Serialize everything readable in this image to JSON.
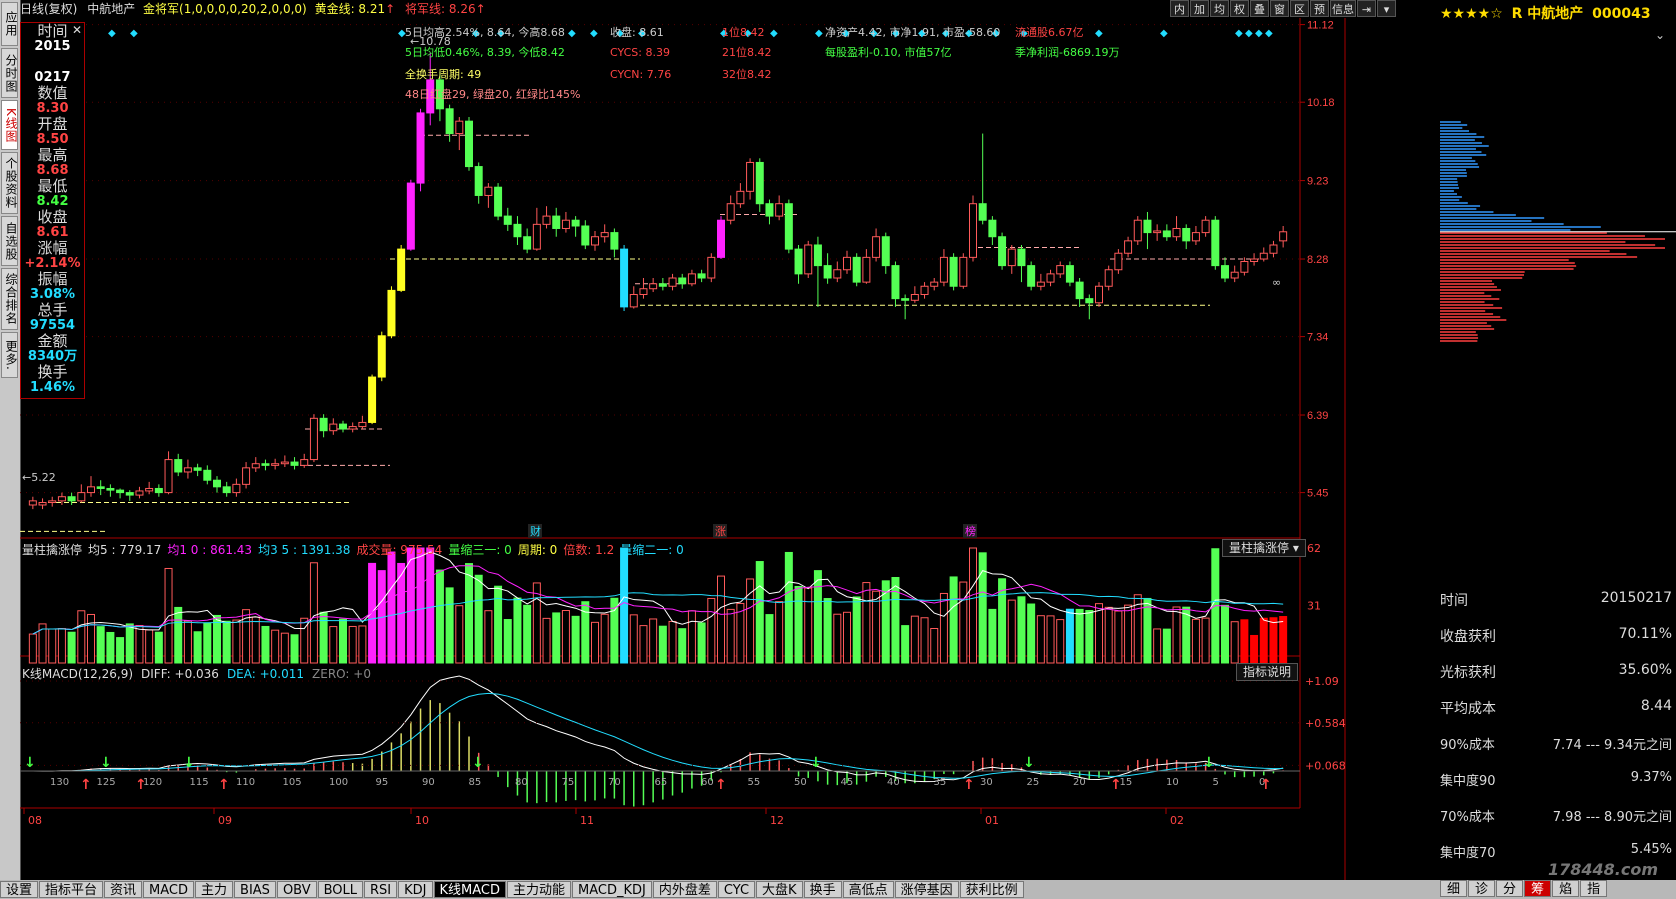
{
  "colors": {
    "up": "#ff5a5a",
    "down": "#54ff54",
    "accent_magenta": "#ff22ff",
    "accent_yellow": "#ffff22",
    "accent_cyan": "#22ddff",
    "axis": "#aa0000",
    "grid": "#550000"
  },
  "sidebar": [
    {
      "label": "应用"
    },
    {
      "label": "分时图"
    },
    {
      "label": "K线图",
      "active": true
    },
    {
      "label": "个股资料"
    },
    {
      "label": "自选股"
    },
    {
      "label": "综合排名"
    },
    {
      "label": "更多."
    }
  ],
  "topbar": {
    "period": "日线(复权)",
    "stock": "中航地产",
    "indicator": "金将军(1,0,0,0,0,20,2,0,0,0)",
    "gold_label": "黄金线: 8.21",
    "gold_arrow": "↑",
    "general_label": "将军线: 8.26",
    "general_arrow": "↑"
  },
  "toolbar": [
    "内",
    "加",
    "均",
    "权",
    "叠",
    "窗",
    "区",
    "预",
    "信息",
    "⇥",
    "▾"
  ],
  "infobox": [
    {
      "label": "时间",
      "value": "2015",
      "color": "#ffffff"
    },
    {
      "label": "",
      "value": "0217",
      "color": "#ffffff"
    },
    {
      "label": "数值",
      "value": "8.30",
      "color": "#ff4444"
    },
    {
      "label": "开盘",
      "value": "8.50",
      "color": "#ff4444"
    },
    {
      "label": "最高",
      "value": "8.68",
      "color": "#ff4444"
    },
    {
      "label": "最低",
      "value": "8.42",
      "color": "#44ff44"
    },
    {
      "label": "收盘",
      "value": "8.61",
      "color": "#ff4444"
    },
    {
      "label": "涨幅",
      "value": "+2.14%",
      "color": "#ff4444"
    },
    {
      "label": "振幅",
      "value": "3.08%",
      "color": "#22ddff"
    },
    {
      "label": "总手",
      "value": "97554",
      "color": "#22ddff"
    },
    {
      "label": "金额",
      "value": "8340万",
      "color": "#22ddff"
    },
    {
      "label": "换手",
      "value": "1.46%",
      "color": "#22ddff"
    }
  ],
  "overlay": [
    {
      "text": "5日均高2.54%, 8.64, 今高8.68",
      "color": "#ccc"
    },
    {
      "text": "5日均低0.46%, 8.39, 今低8.42",
      "color": "#44ff44"
    },
    {
      "text": "全换手周期: 49",
      "color": "#ffff66"
    },
    {
      "text": "48日红盘29, 绿盘20, 红绿比145%",
      "color": "#ff8888"
    },
    {
      "text": "收盘: 8.61",
      "color": "#ccc"
    },
    {
      "text": "CYCS: 8.39",
      "color": "#ff4444"
    },
    {
      "text": "CYCN: 7.76",
      "color": "#ff4444"
    },
    {
      "text": "1位8.42",
      "color": "#ff4444"
    },
    {
      "text": "21位8.42",
      "color": "#ff4444"
    },
    {
      "text": "32位8.42",
      "color": "#ff4444"
    },
    {
      "text": "净资产4.42, 市净1.91, 市盈-58.60",
      "color": "#ccc"
    },
    {
      "text": "每股盈利-0.10, 市值57亿",
      "color": "#44ff44"
    },
    {
      "text": "流通股6.67亿",
      "color": "#ff4444"
    },
    {
      "text": "季净利润-6869.19万",
      "color": "#44ff44"
    },
    {
      "text": "←10.78",
      "color": "#ccc"
    },
    {
      "text": "←5.22",
      "color": "#ccc"
    },
    {
      "text": "∞",
      "color": "#ccc"
    }
  ],
  "event_tags": [
    {
      "text": "财",
      "color": "#22ddff"
    },
    {
      "text": "涨",
      "color": "#ff4444"
    },
    {
      "text": "榜",
      "color": "#ff22ff"
    }
  ],
  "price_axis": [
    "11.12",
    "10.18",
    "9.23",
    "8.28",
    "7.34",
    "6.39",
    "5.45"
  ],
  "vol_header": {
    "name": "量柱擒涨停",
    "ma5": "均5 : 779.17",
    "ma1": "均1 0 : 861.43",
    "ma35": "均3 5 : 1391.38",
    "vol": "成交量: 975.54",
    "s3": "量缩三一: 0",
    "cycle": "周期: 0",
    "mult": "倍数: 1.2",
    "s2": "量缩二一: 0",
    "dropdown": "量柱擒涨停 ▾"
  },
  "vol_axis": [
    "62",
    "31"
  ],
  "macd_header": {
    "name": "K线MACD(12,26,9)",
    "diff": "DIFF: +0.036",
    "dea": "DEA: +0.011",
    "zero": "ZERO: +0",
    "help": "指标说明"
  },
  "macd_axis": [
    "+1.09",
    "+0.584",
    "+0.068"
  ],
  "macd_countdown": [
    "130",
    "125",
    "120",
    "115",
    "110",
    "105",
    "100",
    "95",
    "90",
    "85",
    "80",
    "75",
    "70",
    "65",
    "60",
    "55",
    "50",
    "45",
    "40",
    "35",
    "30",
    "25",
    "20",
    "15",
    "10",
    "5",
    "0"
  ],
  "months": [
    "08",
    "09",
    "10",
    "11",
    "12",
    "01",
    "02"
  ],
  "right": {
    "title": "R 中航地产",
    "code": "000043",
    "stars": "★★★★☆"
  },
  "stats": [
    {
      "label": "时间",
      "value": "20150217"
    },
    {
      "label": "收盘获利",
      "value": "70.11%"
    },
    {
      "label": "光标获利",
      "value": "35.60%"
    },
    {
      "label": "平均成本",
      "value": "8.44"
    },
    {
      "label": "90%成本",
      "value": "7.74 --- 9.34元之间"
    },
    {
      "label": "集中度90",
      "value": "9.37%"
    },
    {
      "label": "70%成本",
      "value": "7.98 --- 8.90元之间"
    },
    {
      "label": "集中度70",
      "value": "5.45%"
    }
  ],
  "watermark": "178448.com",
  "bottom_tabs": [
    "设置",
    "指标平台",
    "资讯",
    "MACD",
    "主力",
    "BIAS",
    "OBV",
    "BOLL",
    "RSI",
    "KDJ",
    "K线MACD",
    "主力动能",
    "MACD_KDJ",
    "内外盘差",
    "CYC",
    "大盘K",
    "换手",
    "高低点",
    "涨停基因",
    "获利比例"
  ],
  "bottom_active": "K线MACD",
  "right_tabs": [
    "细",
    "诊",
    "分",
    "筹",
    "焰",
    "指"
  ],
  "right_active": "筹",
  "chart_data": {
    "type": "candlestick",
    "price_range": [
      4.9,
      11.2
    ],
    "candles": [
      [
        5.3,
        5.35,
        5.4,
        5.25
      ],
      [
        5.3,
        5.33,
        5.38,
        5.25
      ],
      [
        5.33,
        5.35,
        5.4,
        5.28
      ],
      [
        5.35,
        5.4,
        5.45,
        5.3
      ],
      [
        5.4,
        5.35,
        5.45,
        5.3
      ],
      [
        5.35,
        5.45,
        5.55,
        5.33
      ],
      [
        5.45,
        5.52,
        5.65,
        5.4
      ],
      [
        5.52,
        5.5,
        5.6,
        5.42
      ],
      [
        5.5,
        5.48,
        5.55,
        5.4
      ],
      [
        5.48,
        5.45,
        5.5,
        5.38
      ],
      [
        5.45,
        5.42,
        5.48,
        5.35
      ],
      [
        5.42,
        5.47,
        5.52,
        5.38
      ],
      [
        5.47,
        5.5,
        5.58,
        5.43
      ],
      [
        5.5,
        5.45,
        5.55,
        5.4
      ],
      [
        5.45,
        5.85,
        5.95,
        5.43
      ],
      [
        5.85,
        5.7,
        5.92,
        5.65
      ],
      [
        5.7,
        5.75,
        5.85,
        5.62
      ],
      [
        5.75,
        5.72,
        5.8,
        5.65
      ],
      [
        5.72,
        5.6,
        5.78,
        5.55
      ],
      [
        5.6,
        5.52,
        5.65,
        5.45
      ],
      [
        5.52,
        5.45,
        5.58,
        5.4
      ],
      [
        5.45,
        5.55,
        5.62,
        5.4
      ],
      [
        5.55,
        5.75,
        5.82,
        5.5
      ],
      [
        5.75,
        5.8,
        5.88,
        5.7
      ],
      [
        5.8,
        5.78,
        5.85,
        5.72
      ],
      [
        5.78,
        5.8,
        5.86,
        5.73
      ],
      [
        5.8,
        5.82,
        5.9,
        5.76
      ],
      [
        5.82,
        5.78,
        5.88,
        5.73
      ],
      [
        5.78,
        5.85,
        5.92,
        5.75
      ],
      [
        5.85,
        6.35,
        6.4,
        5.82
      ],
      [
        6.35,
        6.2,
        6.4,
        6.12
      ],
      [
        6.2,
        6.28,
        6.35,
        6.15
      ],
      [
        6.28,
        6.22,
        6.32,
        6.18
      ],
      [
        6.22,
        6.25,
        6.3,
        6.18
      ],
      [
        6.25,
        6.3,
        6.38,
        6.22
      ],
      [
        6.3,
        6.85,
        6.88,
        6.28
      ],
      [
        6.85,
        7.35,
        7.4,
        6.8
      ],
      [
        7.35,
        7.9,
        7.95,
        7.32
      ],
      [
        7.9,
        8.4,
        8.45,
        7.88
      ],
      [
        8.4,
        9.2,
        9.24,
        8.38
      ],
      [
        9.2,
        10.05,
        10.1,
        9.1
      ],
      [
        10.05,
        10.45,
        10.78,
        9.9
      ],
      [
        10.45,
        10.1,
        10.55,
        9.95
      ],
      [
        10.1,
        9.8,
        10.15,
        9.7
      ],
      [
        9.8,
        9.95,
        10.0,
        9.6
      ],
      [
        9.95,
        9.4,
        10.0,
        9.35
      ],
      [
        9.4,
        9.05,
        9.45,
        8.95
      ],
      [
        9.05,
        9.15,
        9.2,
        8.9
      ],
      [
        9.15,
        8.8,
        9.2,
        8.75
      ],
      [
        8.8,
        8.7,
        8.9,
        8.62
      ],
      [
        8.7,
        8.55,
        8.8,
        8.45
      ],
      [
        8.55,
        8.4,
        8.65,
        8.35
      ],
      [
        8.4,
        8.7,
        8.9,
        8.38
      ],
      [
        8.7,
        8.8,
        8.92,
        8.65
      ],
      [
        8.8,
        8.65,
        8.9,
        8.55
      ],
      [
        8.65,
        8.75,
        8.85,
        8.6
      ],
      [
        8.75,
        8.68,
        8.8,
        8.55
      ],
      [
        8.68,
        8.45,
        8.75,
        8.4
      ],
      [
        8.45,
        8.55,
        8.62,
        8.38
      ],
      [
        8.55,
        8.6,
        8.7,
        8.48
      ],
      [
        8.6,
        8.4,
        8.65,
        8.3
      ],
      [
        8.4,
        7.7,
        8.45,
        7.65
      ],
      [
        7.7,
        7.85,
        7.95,
        7.68
      ],
      [
        7.85,
        7.92,
        8.05,
        7.8
      ],
      [
        7.92,
        7.98,
        8.05,
        7.88
      ],
      [
        7.98,
        7.95,
        8.05,
        7.9
      ],
      [
        7.95,
        8.05,
        8.1,
        7.9
      ],
      [
        8.05,
        7.98,
        8.1,
        7.92
      ],
      [
        7.98,
        8.1,
        8.15,
        7.95
      ],
      [
        8.1,
        8.05,
        8.15,
        8.0
      ],
      [
        8.05,
        8.3,
        8.35,
        8.0
      ],
      [
        8.3,
        8.75,
        8.8,
        8.28
      ],
      [
        8.75,
        8.95,
        9.05,
        8.7
      ],
      [
        8.95,
        9.1,
        9.2,
        8.9
      ],
      [
        9.1,
        9.45,
        9.5,
        9.0
      ],
      [
        9.45,
        8.95,
        9.5,
        8.85
      ],
      [
        8.95,
        8.8,
        9.0,
        8.7
      ],
      [
        8.8,
        8.95,
        9.05,
        8.75
      ],
      [
        8.95,
        8.4,
        9.0,
        8.35
      ],
      [
        8.4,
        8.1,
        8.45,
        7.98
      ],
      [
        8.1,
        8.45,
        8.5,
        8.05
      ],
      [
        8.45,
        8.2,
        8.55,
        7.7
      ],
      [
        8.2,
        8.05,
        8.35,
        7.98
      ],
      [
        8.05,
        8.15,
        8.25,
        8.0
      ],
      [
        8.15,
        8.3,
        8.38,
        8.1
      ],
      [
        8.3,
        8.0,
        8.35,
        7.95
      ],
      [
        8.0,
        8.3,
        8.4,
        7.98
      ],
      [
        8.3,
        8.55,
        8.65,
        8.25
      ],
      [
        8.55,
        8.2,
        8.6,
        8.1
      ],
      [
        8.2,
        7.8,
        8.25,
        7.7
      ],
      [
        7.8,
        7.78,
        7.85,
        7.55
      ],
      [
        7.78,
        7.85,
        7.95,
        7.75
      ],
      [
        7.85,
        7.95,
        8.0,
        7.8
      ],
      [
        7.95,
        8.0,
        8.05,
        7.9
      ],
      [
        8.0,
        8.3,
        8.4,
        7.95
      ],
      [
        8.3,
        7.95,
        8.35,
        7.9
      ],
      [
        7.95,
        8.3,
        8.35,
        7.92
      ],
      [
        8.3,
        8.95,
        9.05,
        8.25
      ],
      [
        8.95,
        8.75,
        9.8,
        8.7
      ],
      [
        8.75,
        8.55,
        8.8,
        8.45
      ],
      [
        8.55,
        8.2,
        8.6,
        8.15
      ],
      [
        8.2,
        8.4,
        8.45,
        8.1
      ],
      [
        8.4,
        8.2,
        8.45,
        8.0
      ],
      [
        8.2,
        7.95,
        8.25,
        7.9
      ],
      [
        7.95,
        8.0,
        8.1,
        7.9
      ],
      [
        8.0,
        8.1,
        8.15,
        7.95
      ],
      [
        8.1,
        8.2,
        8.25,
        8.05
      ],
      [
        8.2,
        8.0,
        8.25,
        7.95
      ],
      [
        8.0,
        7.8,
        8.05,
        7.7
      ],
      [
        7.8,
        7.75,
        7.85,
        7.55
      ],
      [
        7.75,
        7.95,
        8.0,
        7.7
      ],
      [
        7.95,
        8.15,
        8.2,
        7.9
      ],
      [
        8.15,
        8.35,
        8.4,
        8.1
      ],
      [
        8.35,
        8.5,
        8.55,
        8.3
      ],
      [
        8.5,
        8.75,
        8.8,
        8.45
      ],
      [
        8.75,
        8.6,
        8.85,
        8.4
      ],
      [
        8.6,
        8.62,
        8.7,
        8.5
      ],
      [
        8.62,
        8.55,
        8.7,
        8.5
      ],
      [
        8.55,
        8.65,
        8.8,
        8.5
      ],
      [
        8.65,
        8.5,
        8.7,
        8.4
      ],
      [
        8.5,
        8.6,
        8.68,
        8.45
      ],
      [
        8.6,
        8.75,
        8.8,
        8.55
      ],
      [
        8.75,
        8.2,
        8.8,
        8.15
      ],
      [
        8.2,
        8.05,
        8.3,
        8.0
      ],
      [
        8.05,
        8.12,
        8.2,
        8.0
      ],
      [
        8.12,
        8.25,
        8.3,
        8.08
      ],
      [
        8.25,
        8.28,
        8.35,
        8.2
      ],
      [
        8.28,
        8.35,
        8.42,
        8.25
      ],
      [
        8.35,
        8.45,
        8.5,
        8.3
      ],
      [
        8.5,
        8.61,
        8.68,
        8.42
      ]
    ]
  }
}
